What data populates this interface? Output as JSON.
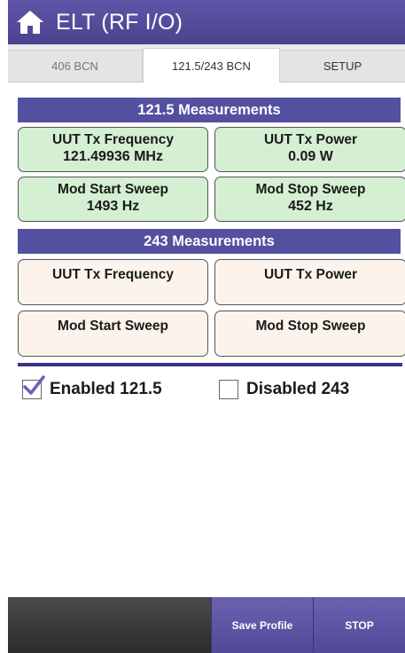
{
  "header": {
    "title": "ELT (RF I/O)",
    "home_icon": "home-icon"
  },
  "tabs": [
    {
      "label": "406 BCN",
      "active": false
    },
    {
      "label": "121.5/243 BCN",
      "active": true
    },
    {
      "label": "SETUP",
      "active": false
    }
  ],
  "section_121": {
    "title": "121.5 Measurements",
    "tx_frequency": {
      "label": "UUT Tx Frequency",
      "value": "121.49936 MHz"
    },
    "tx_power": {
      "label": "UUT Tx Power",
      "value": "0.09 W"
    },
    "mod_start": {
      "label": "Mod Start Sweep",
      "value": "1493 Hz"
    },
    "mod_stop": {
      "label": "Mod Stop Sweep",
      "value": "452 Hz"
    }
  },
  "section_243": {
    "title": "243 Measurements",
    "tx_frequency": {
      "label": "UUT Tx Frequency",
      "value": ""
    },
    "tx_power": {
      "label": "UUT Tx Power",
      "value": ""
    },
    "mod_start": {
      "label": "Mod Start Sweep",
      "value": ""
    },
    "mod_stop": {
      "label": "Mod Stop Sweep",
      "value": ""
    }
  },
  "checkboxes": [
    {
      "label": "Enabled 121.5",
      "checked": true
    },
    {
      "label": "Disabled 243",
      "checked": false
    }
  ],
  "bottom_bar": {
    "save_label": "Save Profile",
    "stop_label": "STOP"
  },
  "colors": {
    "accent": "#5450a0",
    "measured_bg": "#d4efd2",
    "empty_bg": "#fcf4ec",
    "check": "#6a5fc0"
  }
}
